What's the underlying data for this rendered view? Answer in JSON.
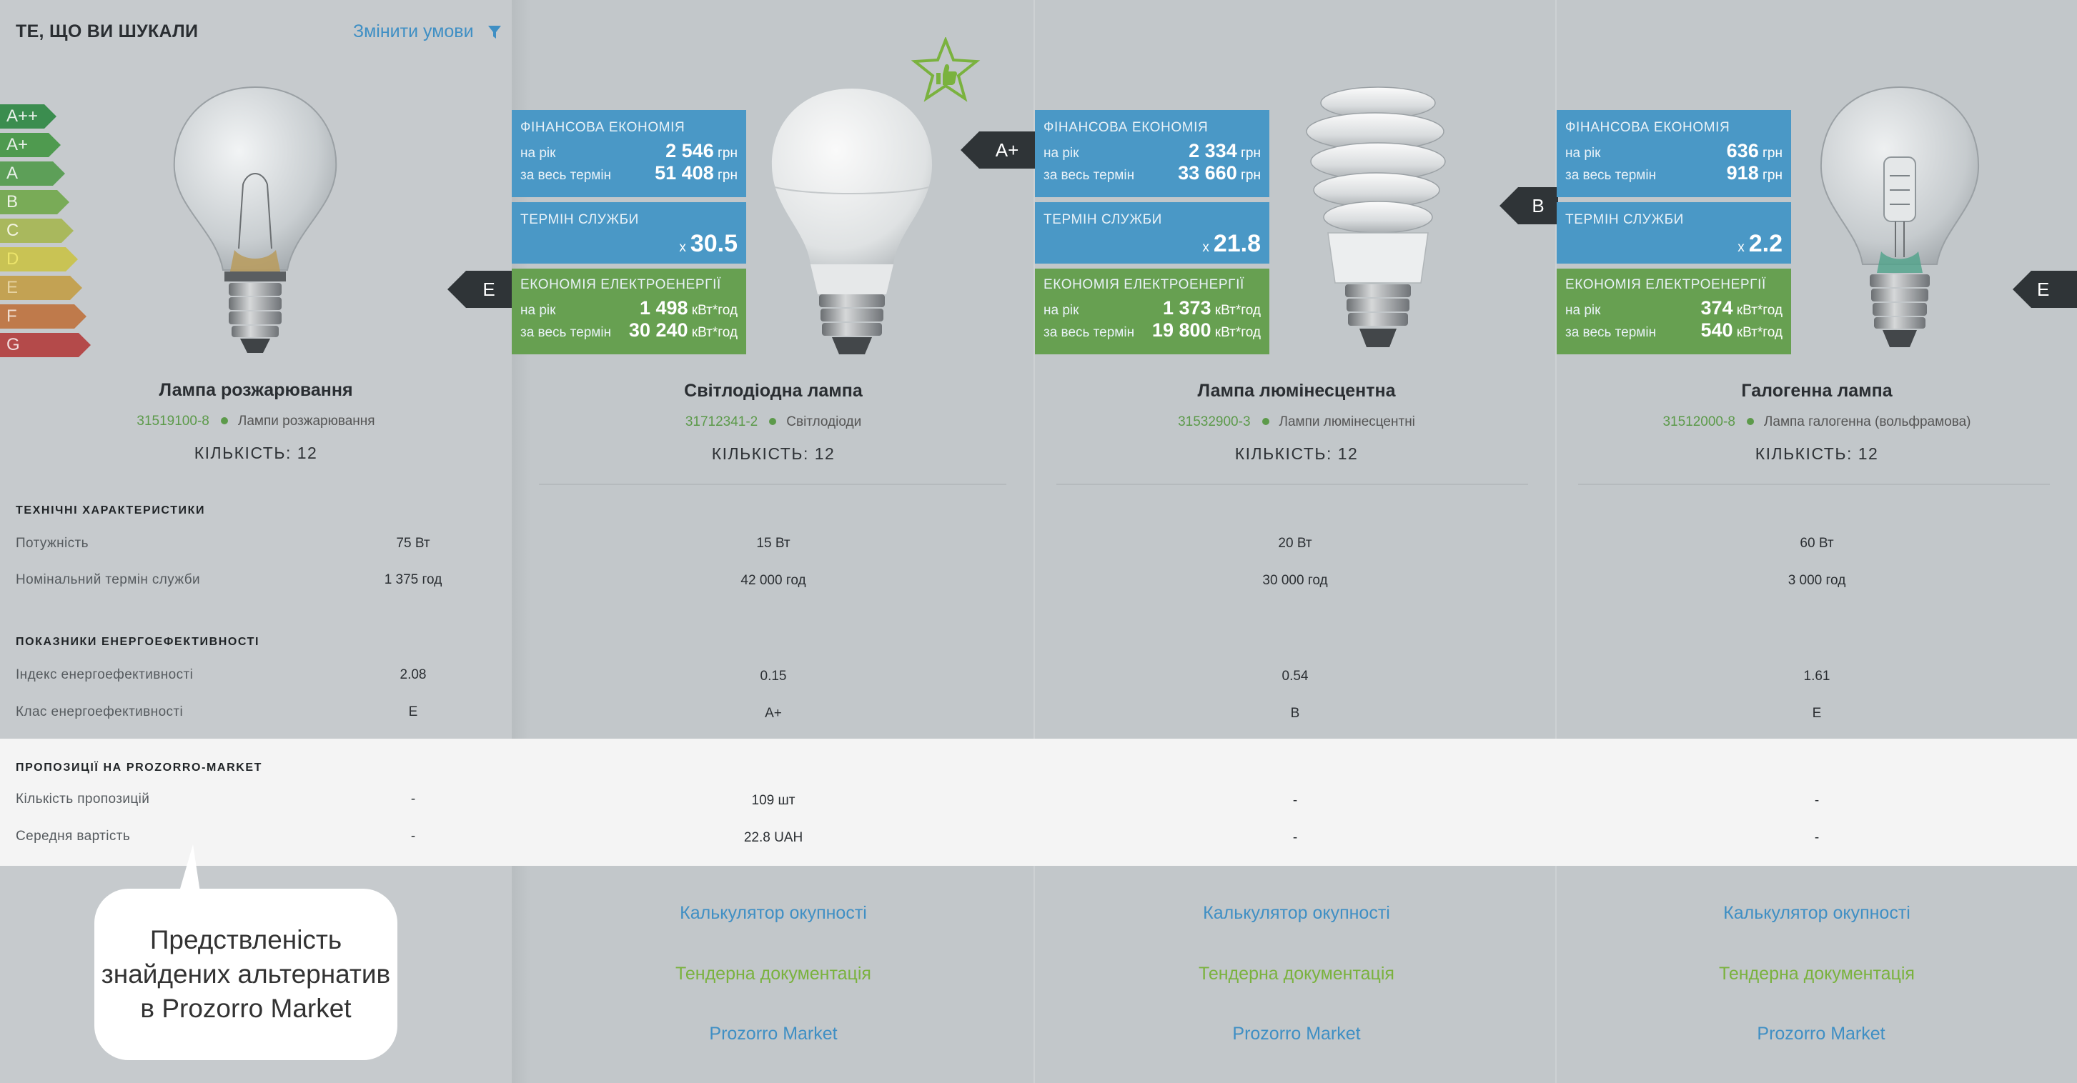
{
  "header": {
    "searched_title": "ТЕ, ЩО ВИ ШУКАЛИ",
    "change_conditions": "Змінити умови"
  },
  "energy_scale": [
    "A++",
    "A+",
    "A",
    "B",
    "C",
    "D",
    "E",
    "F",
    "G"
  ],
  "colors": {
    "fin_box": "#4a98c6",
    "eco_box": "#67a051",
    "link_blue": "#3f8fc4",
    "link_green": "#7ab23e"
  },
  "searched": {
    "name": "Лампа розжарювання",
    "code": "31519100-8",
    "category": "Лампи розжарювання",
    "quantity": "КІЛЬКІСТЬ: 12",
    "class": "E"
  },
  "sections": {
    "tech": "ТЕХНІЧНІ ХАРАКТЕРИСТИКИ",
    "energy": "ПОКАЗНИКИ ЕНЕРГОЕФЕКТИВНОСТІ",
    "market": "ПРОПОЗИЦІЇ НА PROZORRO-MARKET"
  },
  "spec_labels": {
    "power": "Потужність",
    "life": "Номінальний термін служби",
    "index": "Індекс енергоефективності",
    "class": "Клас енергоефективності",
    "offers": "Кількість пропозицій",
    "avg_price": "Середня вартість"
  },
  "searched_specs": {
    "power": "75 Вт",
    "life": "1 375 год",
    "index": "2.08",
    "class": "E",
    "offers": "-",
    "avg_price": "-"
  },
  "box_labels": {
    "financial": "ФІНАНСОВА ЕКОНОМІЯ",
    "per_year": "на рік",
    "whole_term": "за весь термін",
    "service_life": "ТЕРМІН СЛУЖБИ",
    "electricity": "ЕКОНОМІЯ ЕЛЕКТРОЕНЕРГІЇ",
    "currency": "грн",
    "kwh": "кВт*год",
    "mult": "x"
  },
  "alternatives": [
    {
      "name": "Світлодіодна лампа",
      "code": "31712341-2",
      "category": "Світлодіоди",
      "quantity": "КІЛЬКІСТЬ: 12",
      "class": "A+",
      "fin_year": "2 546",
      "fin_total": "51 408",
      "life_mult": "30.5",
      "eco_year": "1 498",
      "eco_total": "30 240",
      "power": "15 Вт",
      "life": "42 000 год",
      "index": "0.15",
      "energy_class": "A+",
      "offers": "109 шт",
      "avg_price": "22.8 UAH",
      "recommended": true
    },
    {
      "name": "Лампа люмінесцентна",
      "code": "31532900-3",
      "category": "Лампи люмінесцентні",
      "quantity": "КІЛЬКІСТЬ: 12",
      "class": "B",
      "fin_year": "2 334",
      "fin_total": "33 660",
      "life_mult": "21.8",
      "eco_year": "1 373",
      "eco_total": "19 800",
      "power": "20 Вт",
      "life": "30 000 год",
      "index": "0.54",
      "energy_class": "B",
      "offers": "-",
      "avg_price": "-"
    },
    {
      "name": "Галогенна лампа",
      "code": "31512000-8",
      "category": "Лампа галогенна (вольфрамова)",
      "quantity": "КІЛЬКІСТЬ: 12",
      "class": "E",
      "fin_year": "636",
      "fin_total": "918",
      "life_mult": "2.2",
      "eco_year": "374",
      "eco_total": "540",
      "power": "60 Вт",
      "life": "3 000 год",
      "index": "1.61",
      "energy_class": "E",
      "offers": "-",
      "avg_price": "-"
    }
  ],
  "links": {
    "calculator": "Калькулятор окупності",
    "tender": "Тендерна документація",
    "market": "Prozorro Market"
  },
  "tooltip": {
    "line1": "Предствленість",
    "line2": "знайдених альтернатив",
    "line3": "в Prozorro Market"
  }
}
